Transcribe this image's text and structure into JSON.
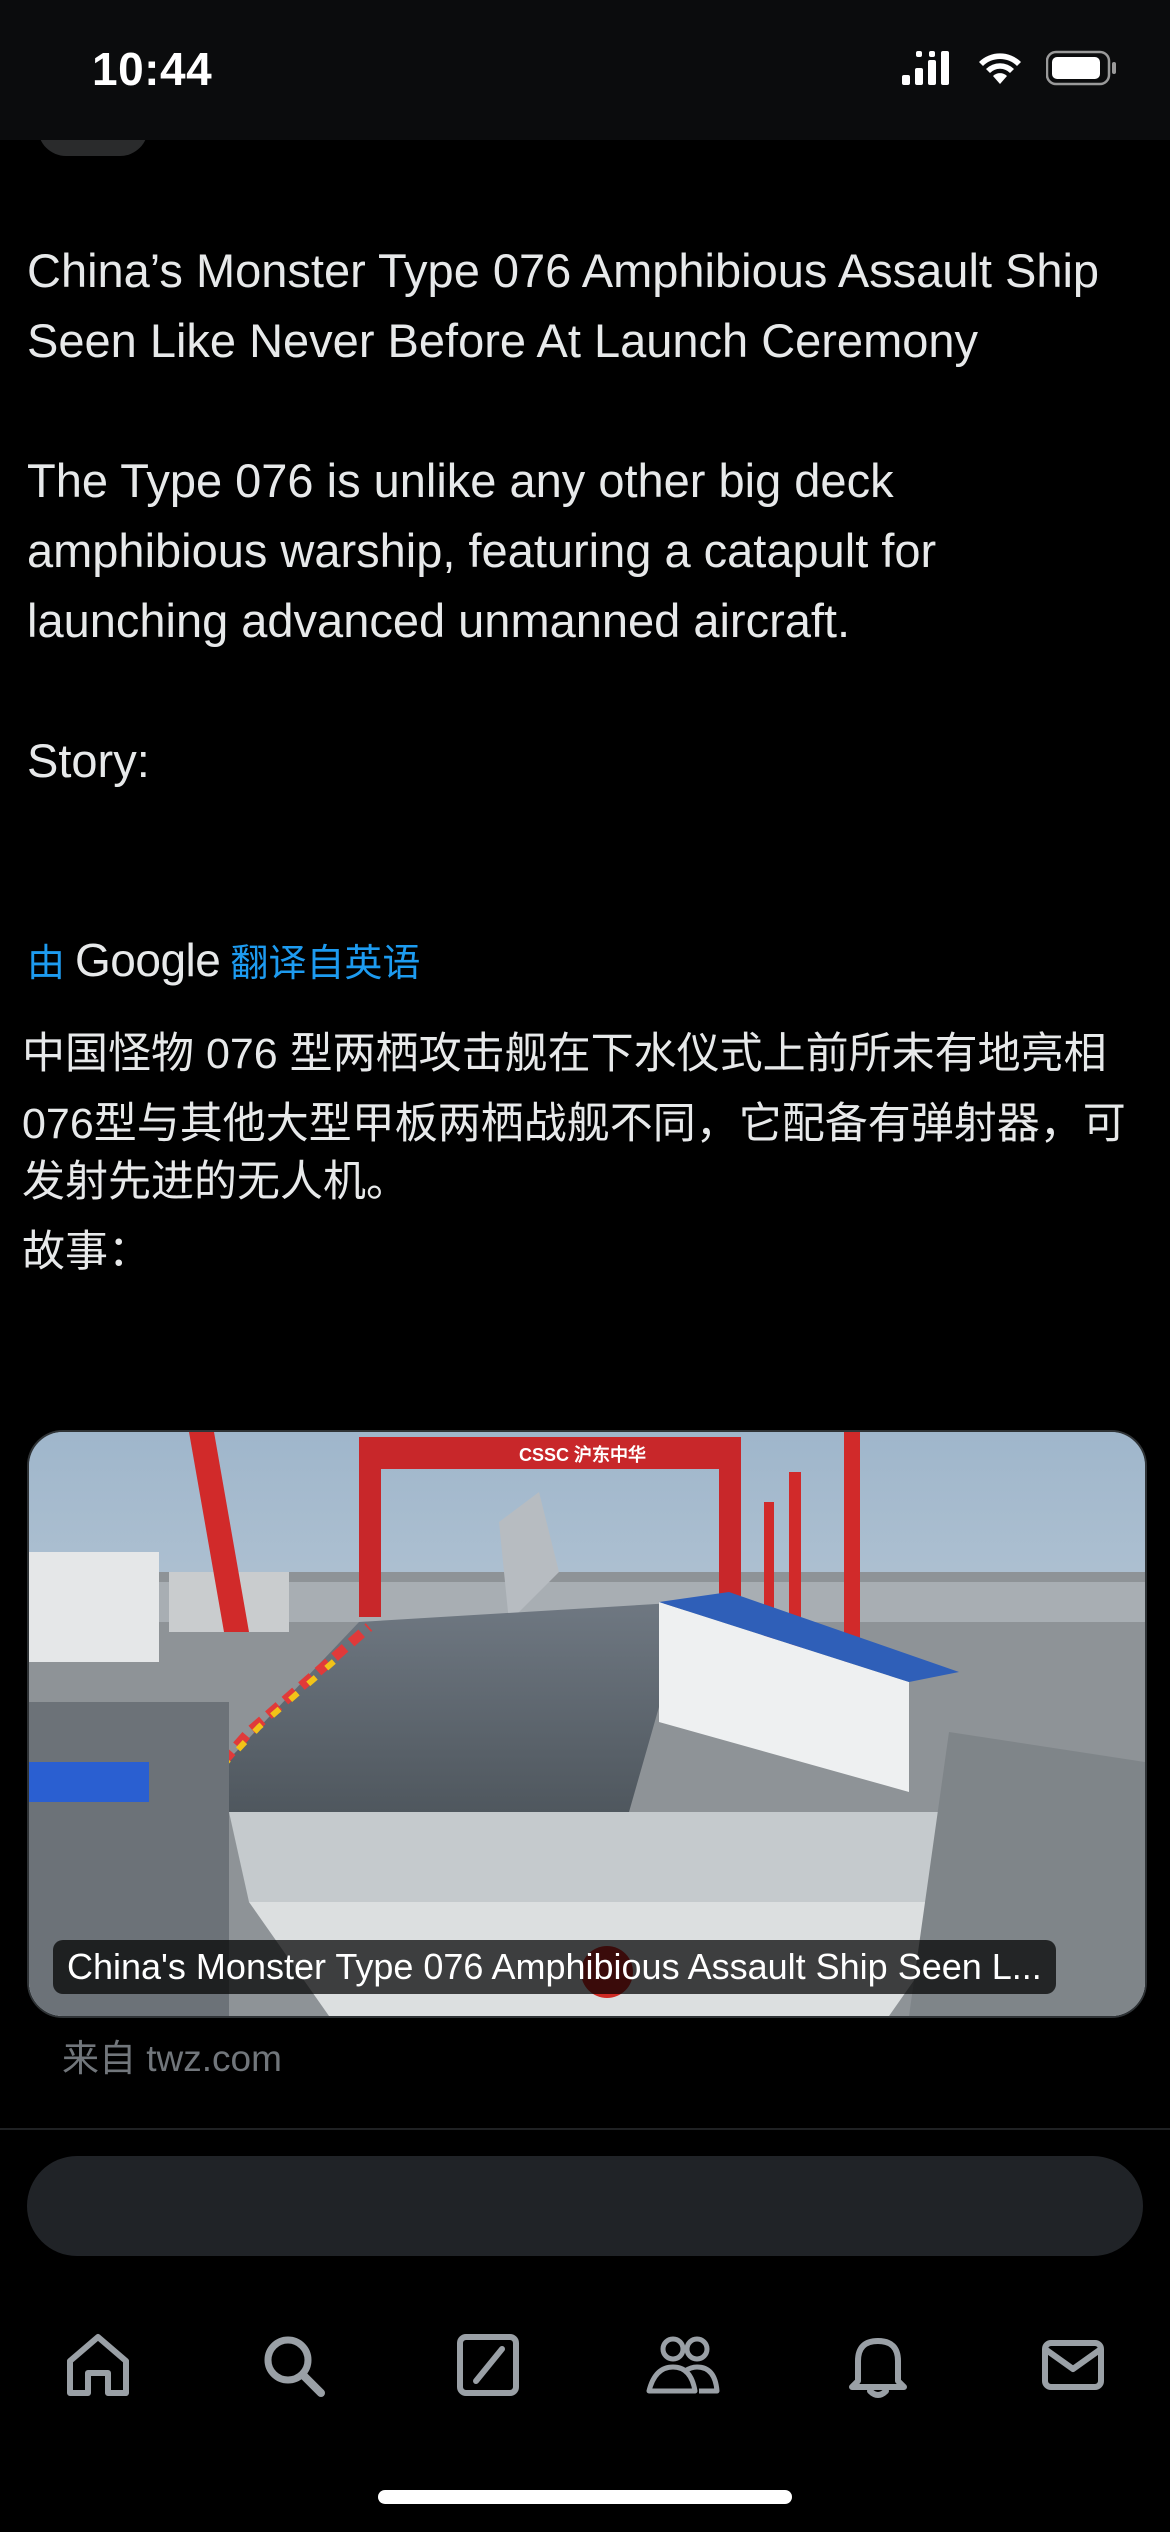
{
  "status_bar": {
    "time": "10:44",
    "icons": [
      "cellular-signal-icon",
      "wifi-icon",
      "battery-icon"
    ]
  },
  "post": {
    "paragraphs": [
      "China’s Monster Type 076 Amphibious Assault Ship Seen Like Never Before At Launch Ceremony",
      "The Type 076 is unlike any other big deck amphibious warship, featuring a catapult for launching advanced unmanned aircraft.",
      "Story:"
    ]
  },
  "translation": {
    "prefix": "由",
    "provider": "Google",
    "suffix": "翻译自英语",
    "paragraphs": [
      "中国怪物 076 型两栖攻击舰在下水仪式上前所未有地亮相",
      "076型与其他大型甲板两栖战舰不同，它配备有弹射器，可发射先进的无人机。",
      "故事："
    ]
  },
  "link_card": {
    "caption": "China's Monster Type 076 Amphibious Assault Ship Seen L...",
    "source": "来自 twz.com",
    "image_sign": "CSSC 沪东中华"
  },
  "reply": {
    "placeholder": ""
  },
  "bottom_nav": {
    "items": [
      "home-icon",
      "search-icon",
      "compose-icon",
      "communities-icon",
      "notifications-icon",
      "messages-icon"
    ]
  },
  "colors": {
    "background": "#000000",
    "text": "#e7e9ea",
    "link": "#1d9bf0",
    "muted": "#71767b",
    "reply_bar": "#202327"
  }
}
